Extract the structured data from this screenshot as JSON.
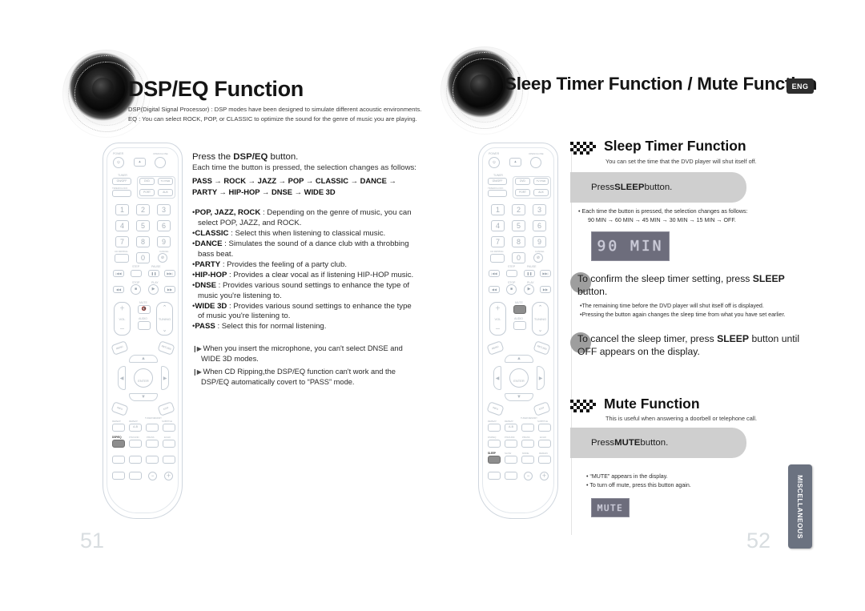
{
  "meta": {
    "lang_badge": "ENG",
    "side_tab": "MISCELLANEOUS"
  },
  "left_page": {
    "number": "51",
    "header": {
      "title": "DSP/EQ Function",
      "sub_line1": "DSP(Digital Signal Processor) : DSP modes have been designed to simulate different acoustic environments.",
      "sub_line2": "EQ : You can select ROCK, POP, or CLASSIC to optimize the sound for the genre of music you are playing."
    },
    "lead": "Press the DSP/EQ button.",
    "lead_bold": "DSP/EQ",
    "sub": "Each time the button is pressed, the selection changes as follows:",
    "flow_line1": "PASS → ROCK → JAZZ → POP → CLASSIC → DANCE →",
    "flow_line2": "PARTY → HIP-HOP → DNSE → WIDE 3D",
    "bullets": [
      {
        "term": "POP, JAZZ, ROCK",
        "desc": " : Depending on the genre of music, you can select POP, JAZZ, and ROCK."
      },
      {
        "term": "CLASSIC",
        "desc": " : Select this when listening to classical music."
      },
      {
        "term": "DANCE",
        "desc": " : Simulates the sound of a dance club with a throbbing bass beat."
      },
      {
        "term": "PARTY",
        "desc": " : Provides the feeling of a party club."
      },
      {
        "term": "HIP-HOP",
        "desc": " : Provides a clear vocal as if listening HIP-HOP music."
      },
      {
        "term": "DNSE",
        "desc": " : Provides various sound settings to enhance the type of music you're listening to."
      },
      {
        "term": "WIDE 3D",
        "desc": " : Provides various sound settings to enhance the type of music you're listening to."
      },
      {
        "term": "PASS",
        "desc": " : Select this for normal listening."
      }
    ],
    "notes": [
      "When you insert the microphone, you can't select DNSE and WIDE 3D modes.",
      "When CD Ripping,the DSP/EQ function can't work and the DSP/EQ automatically covert to “PASS” mode."
    ]
  },
  "right_page": {
    "number": "52",
    "header": {
      "title": "Sleep Timer Function / Mute Function"
    },
    "sleep": {
      "title": "Sleep Timer Function",
      "sub": "You can set the time that the DVD player will shut itself off.",
      "step1_prefix": "Press ",
      "step1_bold": "SLEEP",
      "step1_suffix": " button.",
      "notes": [
        "Each time the button is pressed, the selection changes as follows:",
        "90 MIN → 60 MIN → 45 MIN → 30 MIN → 15 MIN → OFF."
      ],
      "lcd": "90 MIN",
      "step2_prefix": "To confirm the sleep timer setting, press ",
      "step2_bold": "SLEEP",
      "step2_suffix": " button.",
      "step2_notes": [
        "The remaining time before the DVD player will shut itself off is displayed.",
        "Pressing the button again changes the sleep time from what you have set earlier."
      ],
      "step3_prefix": "To cancel the sleep timer, press ",
      "step3_bold": "SLEEP",
      "step3_suffix": " button until OFF appears on the display."
    },
    "mute": {
      "title": "Mute Function",
      "sub": "This is useful when answering a doorbell or telephone call.",
      "step1_prefix": "Press ",
      "step1_bold": "MUTE",
      "step1_suffix": " button.",
      "notes": [
        "“MUTE” appears in the display.",
        "To turn off mute, press this button again."
      ],
      "lcd": "MUTE"
    }
  },
  "remote_left": {
    "power_label": "POWER",
    "open_close_label": "OPEN/CLOSE",
    "tuner_label": "TUNER",
    "onoff_label": "ON/OFF",
    "timer_clock_label": "TIMER/CLOCK",
    "dvd_label": "DVD",
    "tvpwr_label": "TV PWR",
    "port_label": "PORT",
    "aux_label": "AUX",
    "numbers": [
      "1",
      "2",
      "3",
      "4",
      "5",
      "6",
      "7",
      "8",
      "9",
      "0"
    ],
    "cd_ripping_label": "CD RIPPING",
    "cancel_label": "CANCEL",
    "stop_label": "STOP",
    "pause_label": "PAUSE",
    "play_label": "PLAY",
    "vol_label": "VOL",
    "mute_label": "MUTE",
    "audio_label": "AUDIO",
    "tuning_label": "TUNING",
    "menu_label": "MENU",
    "return_label": "RETURN",
    "enter_label": "ENTER",
    "info_label": "INFO",
    "exit_label": "EXIT",
    "repeat_label": "REPEAT",
    "repeat_ab_label": "REPEAT A-B",
    "tuner_memory_label": "TUNER MEMORY",
    "subtitle_label": "SUBTITLE",
    "dspeq_label": "DSP/EQ",
    "psound_label": "P/SOUND",
    "pbass_label": "P.BASS",
    "echo_label": "ECHO",
    "highlight": "DSP/EQ"
  },
  "remote_right": {
    "highlight1": "MUTE",
    "highlight2": "SLEEP",
    "sleep_label": "SLEEP",
    "slow_label": "SLOW",
    "mode_label": "MODE",
    "remain_label": "REMAIN"
  }
}
